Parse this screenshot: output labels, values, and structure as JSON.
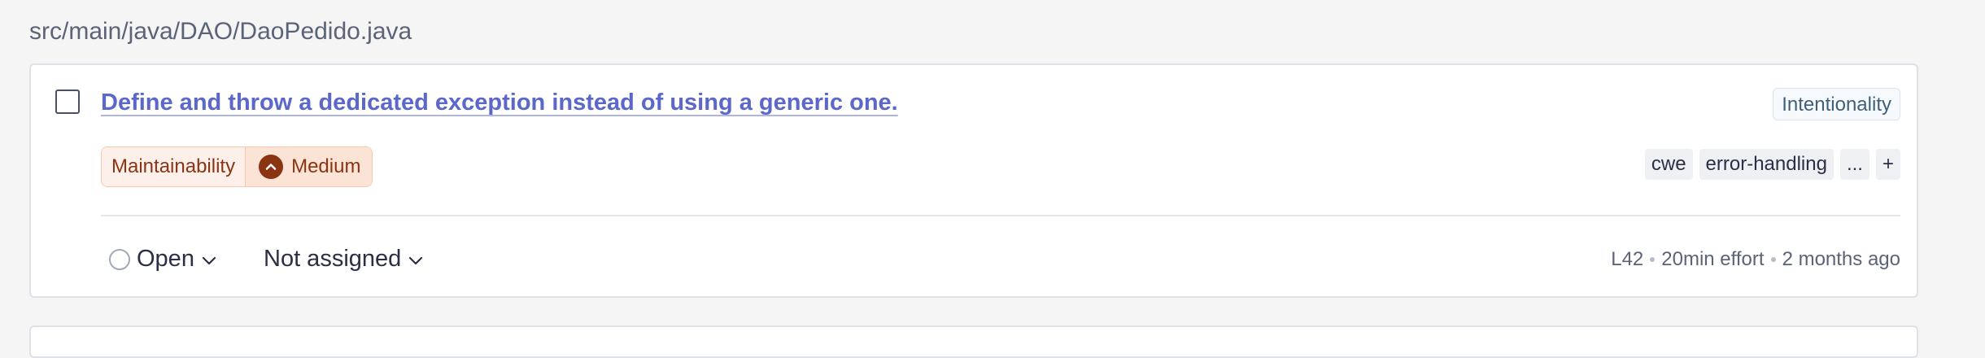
{
  "file_path": "src/main/java/DAO/DaoPedido.java",
  "issue": {
    "title": "Define and throw a dedicated exception instead of using a generic one.",
    "attribute": "Intentionality",
    "impact": {
      "quality": "Maintainability",
      "severity": "Medium",
      "severity_icon": "chevron-up-icon"
    },
    "tags": [
      "cwe",
      "error-handling",
      "...",
      "+"
    ],
    "status": "Open",
    "assignee": "Not assigned",
    "meta": {
      "line": "L42",
      "effort": "20min effort",
      "age": "2 months ago"
    }
  },
  "colors": {
    "link": "#5b67c9",
    "severity_medium": "#8a3412",
    "severity_bg": "#fbe3d6"
  }
}
